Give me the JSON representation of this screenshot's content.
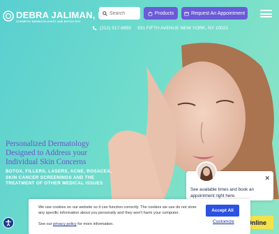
{
  "brand": {
    "name": "DEBRA JALIMAN, MD",
    "tagline": "COSMETIC DERMATOLOGIST AND BOTOX NYC"
  },
  "header": {
    "search_placeholder": "Search",
    "products_label": "Products",
    "appointment_label": "Request An Appointment",
    "phone": "(212) 517-8855",
    "address": "931 FIFTH AVENUE NEW YORK, NY 10021"
  },
  "hero": {
    "title": "Personalized Dermatology Designed to Address your Individual Skin Concerns",
    "subtitle": "BOTOX, FILLERS, LASERS, ACNE, ROSACEA, SKIN CANCER SCREENINGS AND THE TREATMENT OF OTHER MEDICAL ISSUES"
  },
  "chat": {
    "message": "See available times and book an appointment right here."
  },
  "book_online": {
    "label": "Online"
  },
  "cookie": {
    "text": "We use cookies on our website so it can function correctly. The cookies we use do not store any specific information about you personally and they won't harm your computer.",
    "policy_prefix": "See our ",
    "policy_link": "privacy policy",
    "policy_suffix": " for more information.",
    "accept_label": "Accept All",
    "customize_label": "Customize"
  },
  "colors": {
    "accent": "#6a5bd8",
    "hero_bg": "#6fdccc",
    "cta_yellow": "#f3e24a",
    "accept_blue": "#2b52e0"
  },
  "icons": {
    "logo": "circle-logo-icon",
    "search": "search-icon",
    "products": "bag-icon",
    "appointment": "calendar-icon",
    "menu": "hamburger-menu-icon",
    "phone": "phone-icon",
    "close": "close-icon",
    "accessibility": "accessibility-icon"
  }
}
